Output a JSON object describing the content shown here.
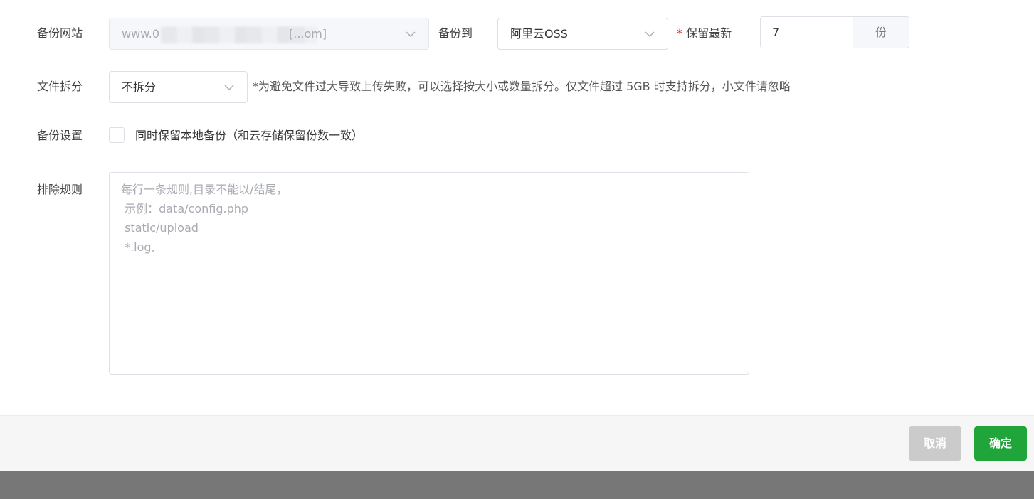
{
  "form": {
    "site": {
      "label": "备份网站",
      "value_prefix": "www.0",
      "value_suffix": "[...om]"
    },
    "target": {
      "label": "备份到",
      "value": "阿里云OSS"
    },
    "keep": {
      "required_mark": "*",
      "label": "保留最新",
      "value": "7",
      "unit": "份"
    },
    "split": {
      "label": "文件拆分",
      "value": "不拆分",
      "hint": "*为避免文件过大导致上传失败，可以选择按大小或数量拆分。仅文件超过 5GB 时支持拆分，小文件请忽略"
    },
    "settings": {
      "label": "备份设置",
      "checkbox_label": "同时保留本地备份（和云存储保留份数一致）",
      "checked": false
    },
    "exclude": {
      "label": "排除规则",
      "placeholder": "每行一条规则,目录不能以/结尾，\n 示例：data/config.php\n static/upload\n *.log,"
    }
  },
  "footer": {
    "cancel_label": "取消",
    "confirm_label": "确定"
  },
  "colors": {
    "primary": "#20a53a",
    "required": "#e02020",
    "disabled_button": "#cbcbcb"
  }
}
